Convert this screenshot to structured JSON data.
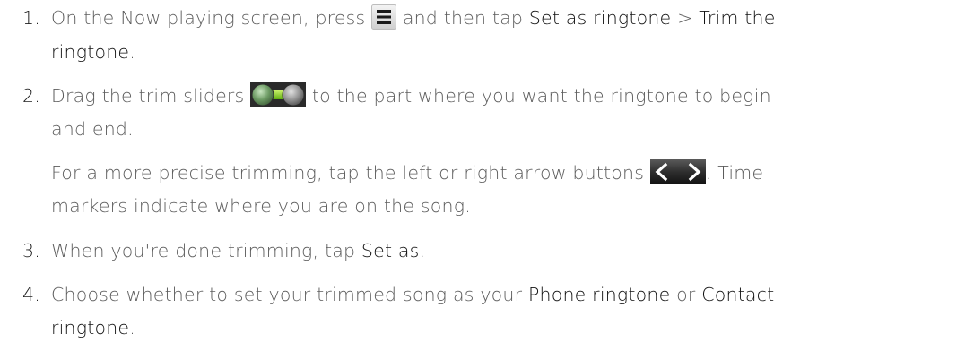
{
  "steps": [
    {
      "number": "1.",
      "lines": [
        {
          "t1": "On the Now playing screen, press ",
          "t2": " and then tap ",
          "b1": "Set as ringtone",
          "t3": " > ",
          "b2": "Trim the"
        },
        {
          "b1": "ringtone",
          "t1": "."
        }
      ],
      "icon": "menu-icon"
    },
    {
      "number": "2.",
      "lines": [
        {
          "t1": "Drag the trim sliders ",
          "t2": " to the part where you want the ringtone to begin"
        },
        {
          "t1": "and end."
        }
      ],
      "icon": "trim-slider-icon",
      "note_lines": [
        {
          "t1": "For a more precise trimming, tap the left or right arrow buttons ",
          "t2": ". Time"
        },
        {
          "t1": "markers indicate where you are on the song."
        }
      ],
      "note_icon": "arrow-buttons-icon"
    },
    {
      "number": "3.",
      "lines": [
        {
          "t1": "When you're done trimming, tap ",
          "b1": "Set as",
          "t2": "."
        }
      ]
    },
    {
      "number": "4.",
      "lines": [
        {
          "t1": "Choose whether to set your trimmed song as your ",
          "b1": "Phone ringtone",
          "t2": " or ",
          "b2": "Contact"
        },
        {
          "b1": "ringtone",
          "t1": "."
        }
      ]
    }
  ]
}
